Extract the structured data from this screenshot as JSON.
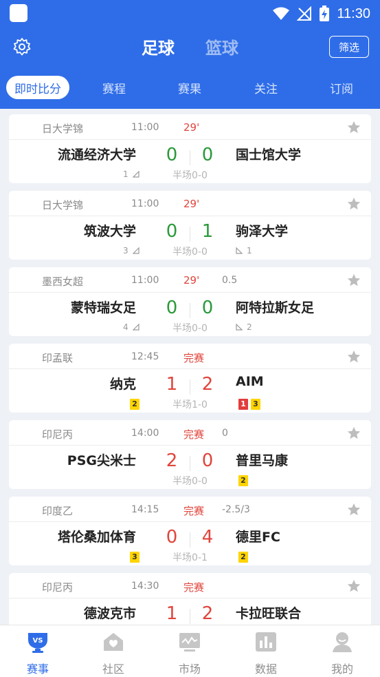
{
  "statusbar": {
    "time": "11:30"
  },
  "header": {
    "sports": [
      "足球",
      "篮球"
    ],
    "filter_label": "筛选",
    "subtabs": [
      "即时比分",
      "赛程",
      "赛果",
      "关注",
      "订阅"
    ]
  },
  "matches": [
    {
      "league": "日大学锦",
      "time": "11:00",
      "status": "29'",
      "handicap": "",
      "home": "流通经济大学",
      "away": "国士馆大学",
      "home_score": "0",
      "away_score": "0",
      "halftime": "半场0-0",
      "home_corners": "1",
      "away_corners": ""
    },
    {
      "league": "日大学锦",
      "time": "11:00",
      "status": "29'",
      "handicap": "",
      "home": "筑波大学",
      "away": "驹泽大学",
      "home_score": "0",
      "away_score": "1",
      "halftime": "半场0-0",
      "home_corners": "3",
      "away_corners": "1"
    },
    {
      "league": "墨西女超",
      "time": "11:00",
      "status": "29'",
      "handicap": "0.5",
      "home": "蒙特瑞女足",
      "away": "阿特拉斯女足",
      "home_score": "0",
      "away_score": "0",
      "halftime": "半场0-0",
      "home_corners": "4",
      "away_corners": "2"
    },
    {
      "league": "印孟联",
      "time": "12:45",
      "status": "完赛",
      "handicap": "",
      "home": "纳克",
      "away": "AIM",
      "home_score": "1",
      "away_score": "2",
      "halftime": "半场1-0",
      "home_yellow": "2",
      "away_red": "1",
      "away_yellow": "3"
    },
    {
      "league": "印尼丙",
      "time": "14:00",
      "status": "完赛",
      "handicap": "0",
      "home": "PSG尖米士",
      "away": "普里马康",
      "home_score": "2",
      "away_score": "0",
      "halftime": "半场0-0",
      "away_yellow": "2"
    },
    {
      "league": "印度乙",
      "time": "14:15",
      "status": "完赛",
      "handicap": "-2.5/3",
      "home": "塔伦桑加体育",
      "away": "德里FC",
      "home_score": "0",
      "away_score": "4",
      "halftime": "半场0-1",
      "home_yellow": "3",
      "away_yellow": "2"
    },
    {
      "league": "印尼丙",
      "time": "14:30",
      "status": "完赛",
      "handicap": "",
      "home": "德波克市",
      "away": "卡拉旺联合",
      "home_score": "1",
      "away_score": "2"
    }
  ],
  "bottom_nav": [
    "赛事",
    "社区",
    "市场",
    "数据",
    "我的"
  ],
  "colors": {
    "primary": "#2f6de8",
    "live_score": "#2a9a3a",
    "final_score": "#e0453c",
    "yellow_card": "#ffd400",
    "red_card": "#e23c3c"
  }
}
